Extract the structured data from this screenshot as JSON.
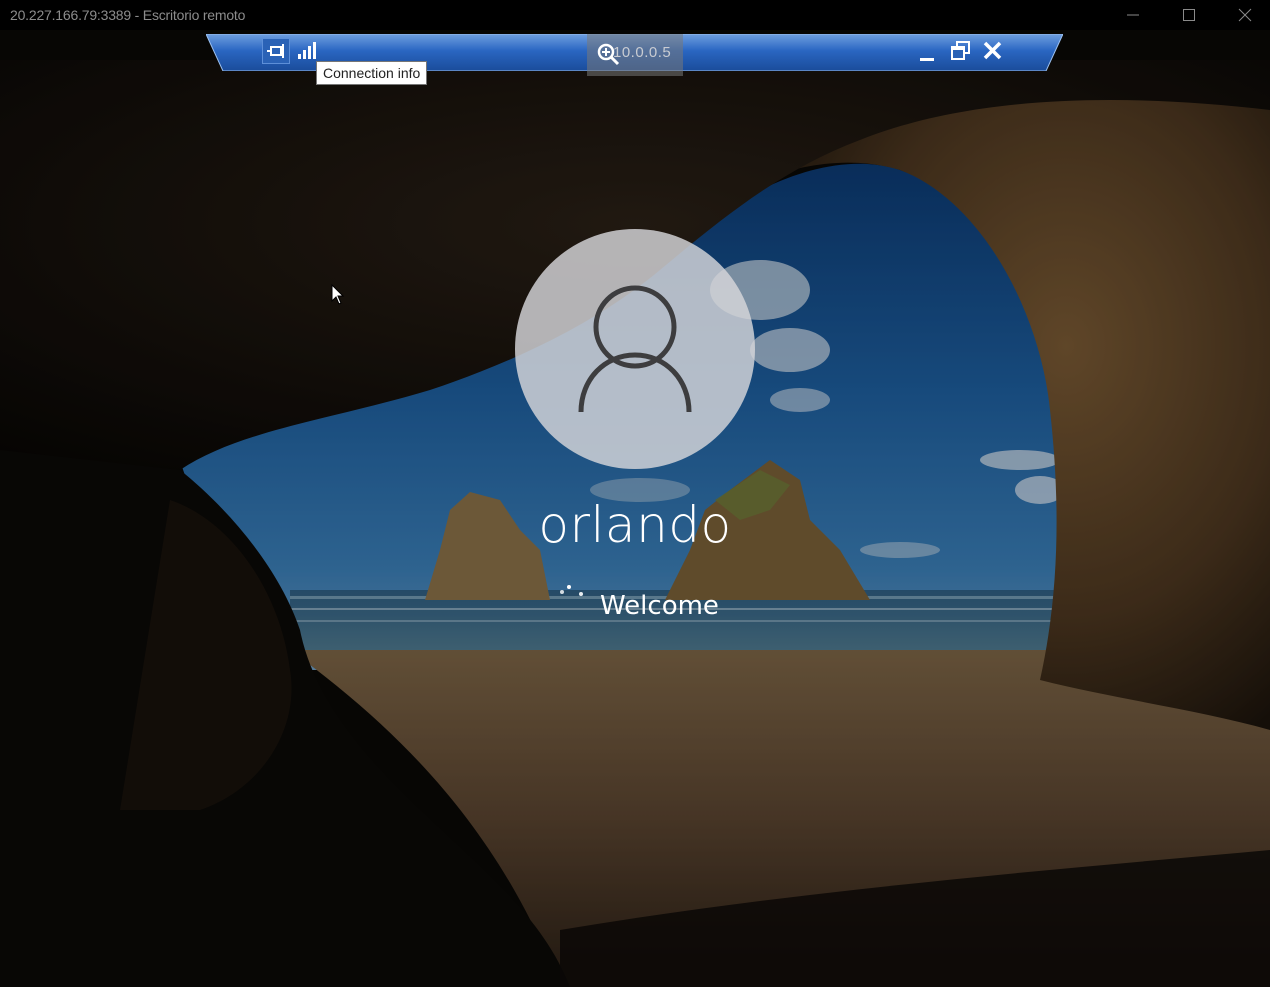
{
  "window": {
    "title": "20.227.166.79:3389 - Escritorio remoto",
    "controls": [
      "minimize",
      "maximize",
      "close"
    ]
  },
  "connection_bar": {
    "address": "10.0.0.5",
    "tooltip": "Connection info",
    "icons": [
      "pin-icon",
      "signal-strength-icon",
      "zoom-icon",
      "minimize-icon",
      "restore-icon",
      "close-icon"
    ],
    "color": "#1f5fb6"
  },
  "login": {
    "username": "orlando",
    "status": "Welcome",
    "icons": [
      "user-avatar-icon",
      "loading-spinner-icon"
    ]
  },
  "background": {
    "description_icon": "windows-lockscreen-cave-beach"
  }
}
